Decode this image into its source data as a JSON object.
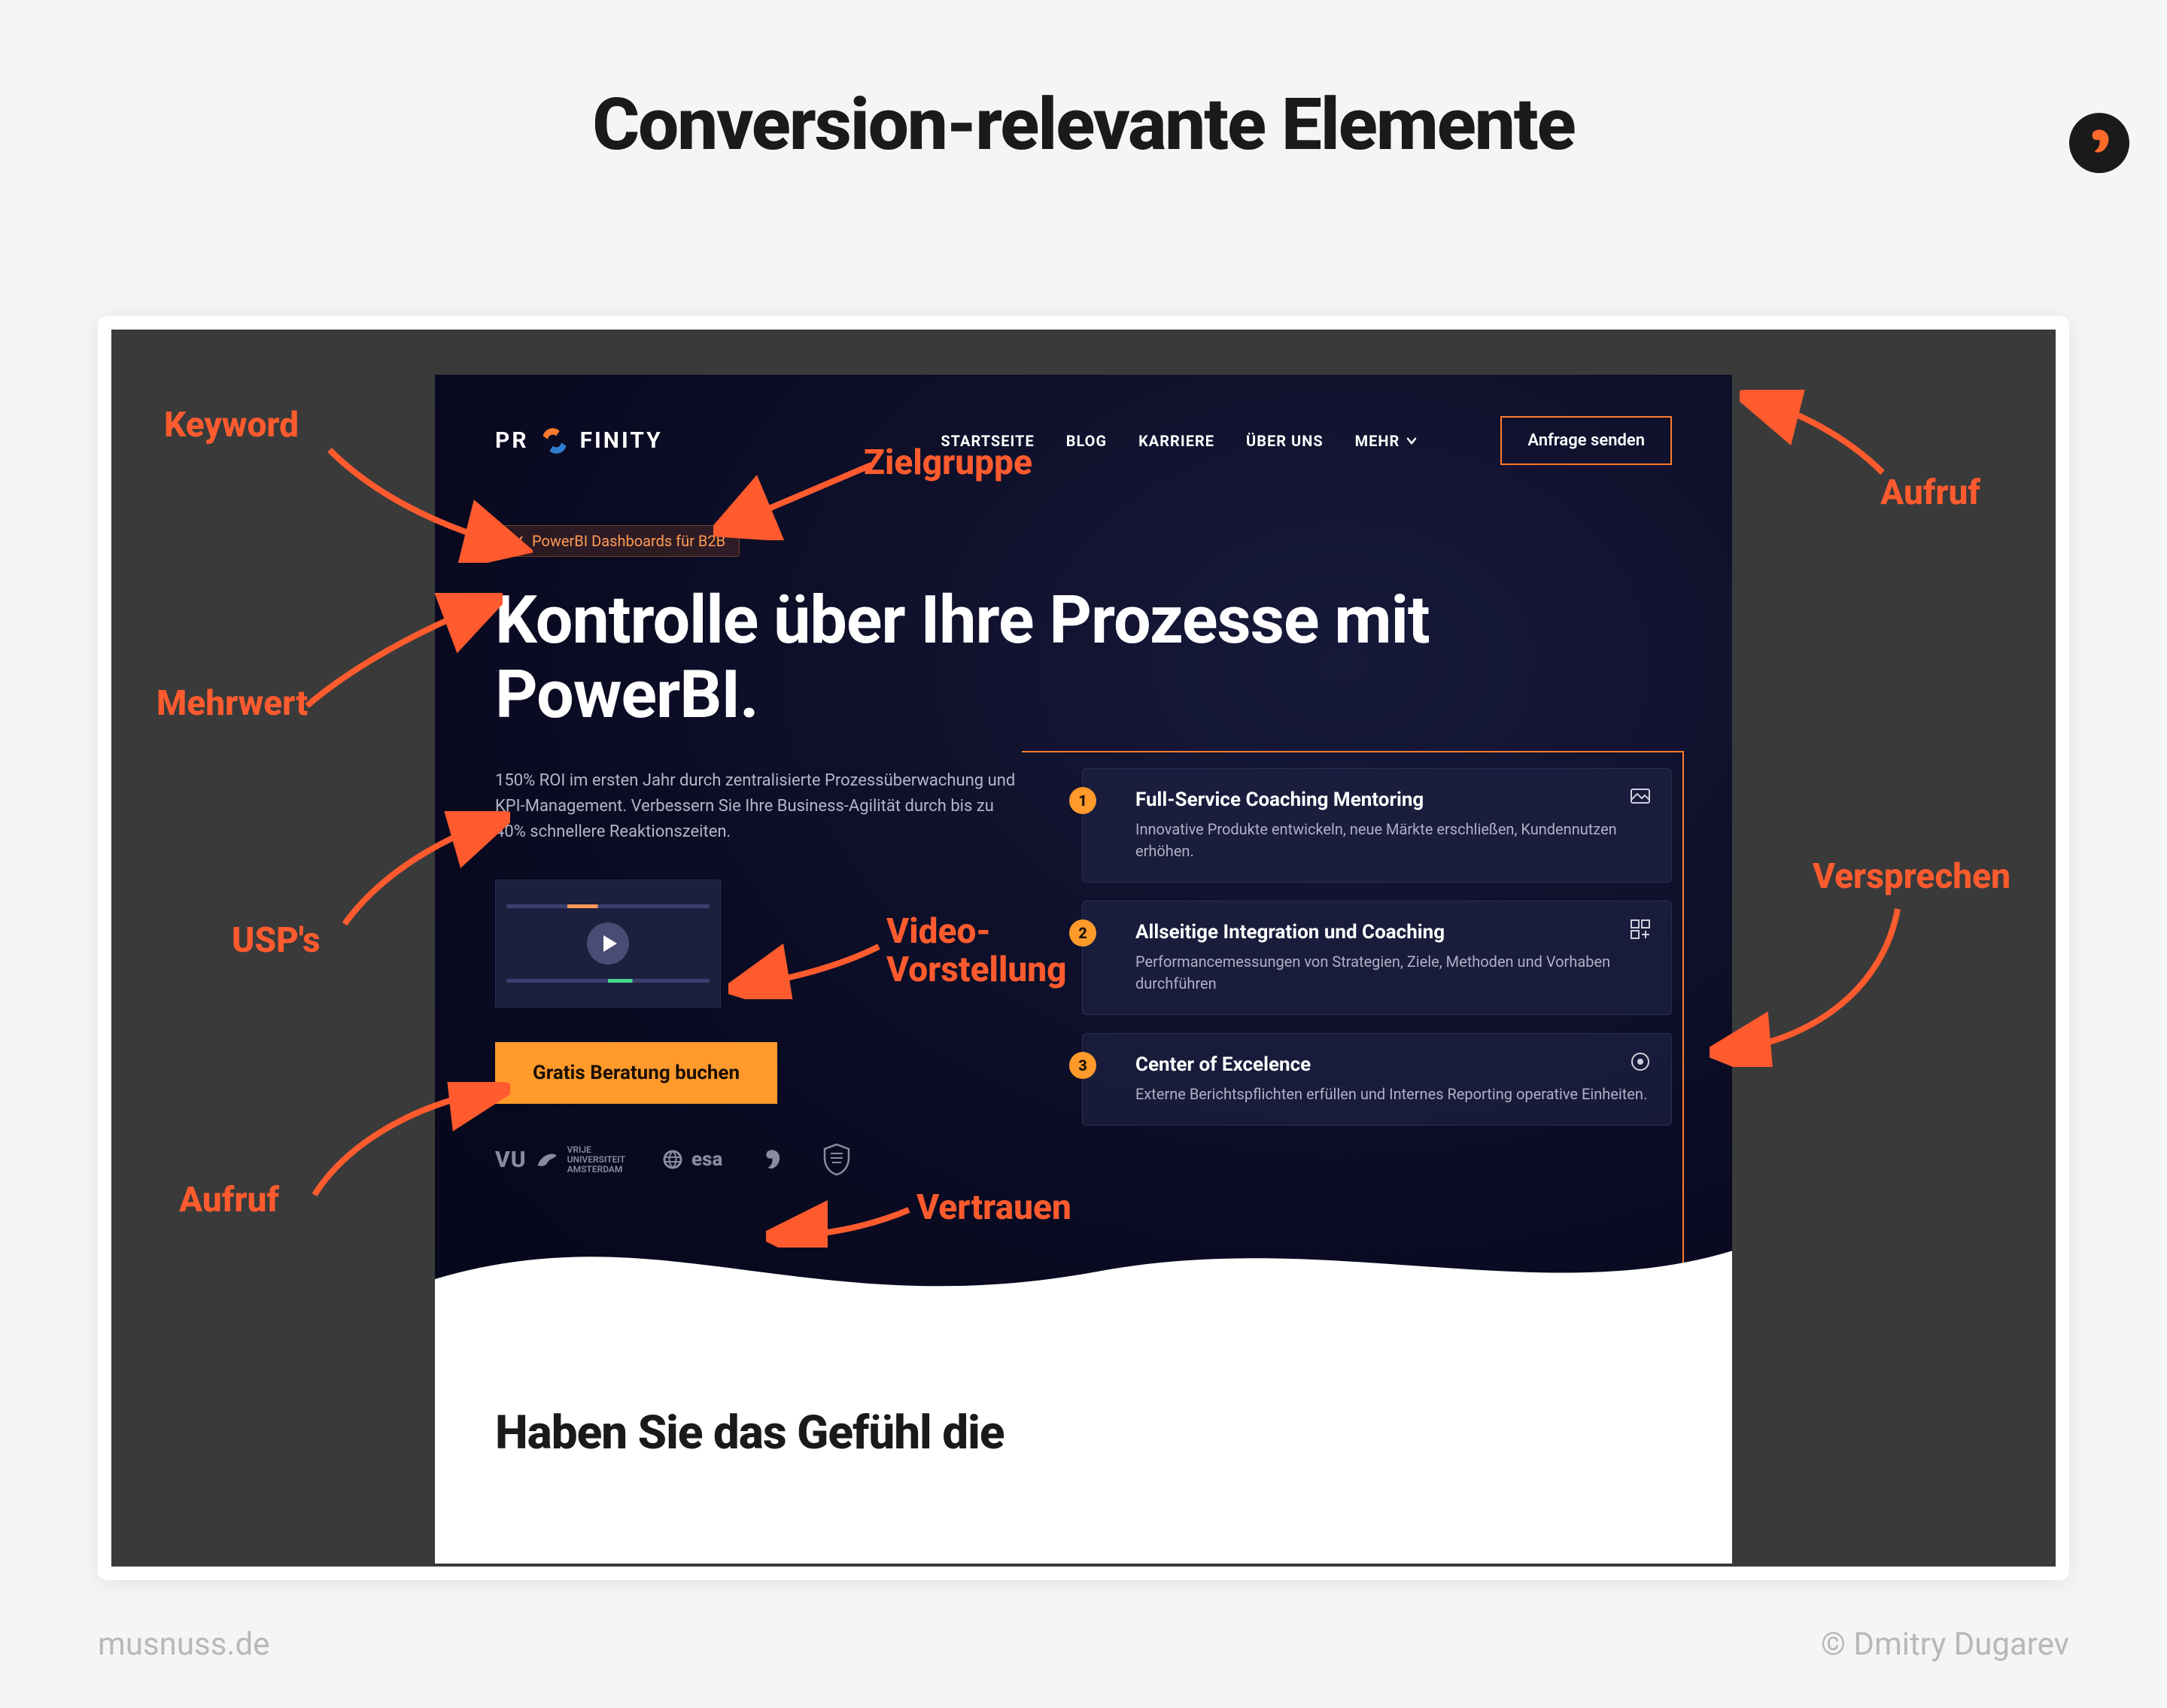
{
  "slide": {
    "title": "Conversion-relevante Elemente"
  },
  "footer": {
    "left": "musnuss.de",
    "right": "© Dmitry Dugarev"
  },
  "site": {
    "brand_pre": "PR",
    "brand_post": "FINITY",
    "nav": {
      "start": "STARTSEITE",
      "blog": "BLOG",
      "career": "KARRIERE",
      "about": "ÜBER UNS",
      "more": "MEHR"
    },
    "cta_nav": "Anfrage senden",
    "badge": "PowerBI Dashboards für B2B",
    "headline": "Kontrolle über Ihre Prozesse mit PowerBI.",
    "desc": "150% ROI im ersten Jahr durch zentralisierte Prozessüberwachung und KPI-Management. Verbessern Sie Ihre Business-Agilität durch bis zu 40% schnellere Reaktionszeiten.",
    "cta_main": "Gratis Beratung buchen",
    "logos": {
      "vu": "VU",
      "vu_sub": "VRIJE\nUNIVERSITEIT\nAMSTERDAM",
      "esa": "esa"
    },
    "features": [
      {
        "n": "1",
        "title": "Full-Service Coaching Mentoring",
        "body": "Innovative Produkte entwickeln, neue Märkte erschließen, Kundennutzen erhöhen."
      },
      {
        "n": "2",
        "title": "Allseitige Integration und Coaching",
        "body": "Performancemessungen von Strategien, Ziele, Methoden und Vorhaben durchführen"
      },
      {
        "n": "3",
        "title": "Center of Excelence",
        "body": "Externe Berichtspflichten erfüllen und Internes Reporting operative Einheiten."
      }
    ],
    "below_heading": "Haben Sie das Gefühl die"
  },
  "annos": {
    "keyword": "Keyword",
    "zielgruppe": "Zielgruppe",
    "mehrwert": "Mehrwert",
    "usps": "USP's",
    "video": "Video-\nVorstellung",
    "aufruf": "Aufruf",
    "aufruf2": "Aufruf",
    "versprechen": "Versprechen",
    "vertrauen": "Vertrauen"
  }
}
